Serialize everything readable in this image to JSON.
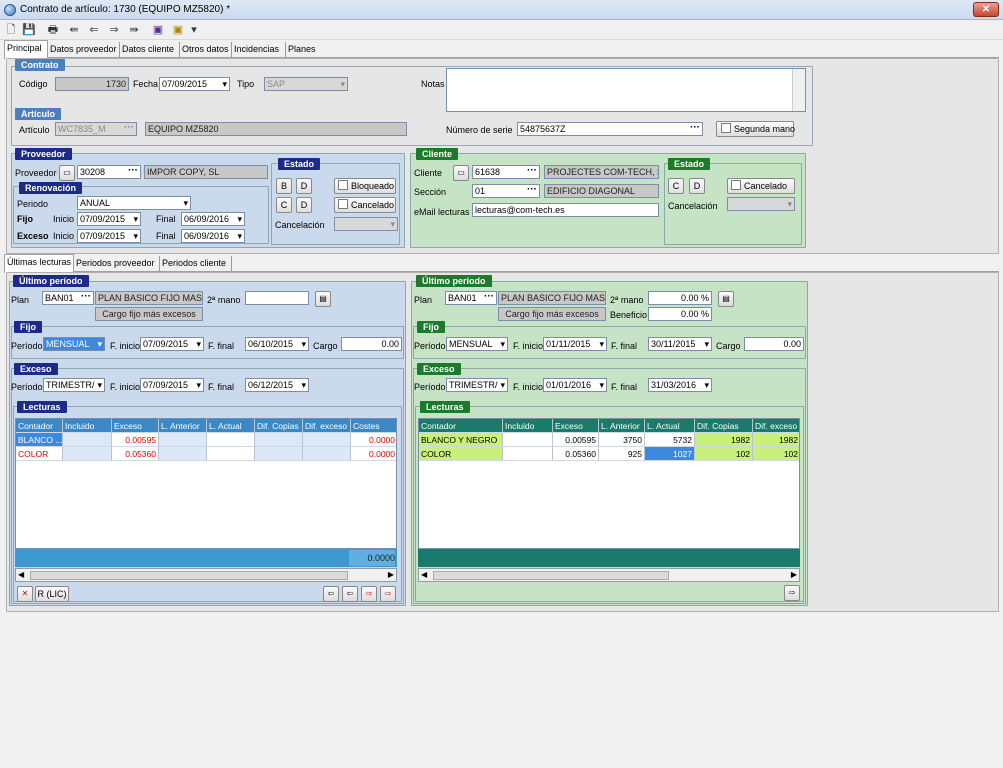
{
  "window": {
    "title": "Contrato de artículo: 1730 (EQUIPO MZ5820) *",
    "close": "✕"
  },
  "toolbar": {
    "new": "🗋",
    "save": "💾",
    "print": "🖶",
    "first": "⇚",
    "prev": "⇐",
    "next": "⇒",
    "last": "⇛",
    "a": "▣",
    "b": "▣",
    "more": "▾"
  },
  "tabs": [
    "Principal",
    "Datos proveedor",
    "Datos cliente",
    "Otros datos",
    "Incidencias",
    "Planes"
  ],
  "contrato": {
    "header": "Contrato",
    "codigo_label": "Código",
    "codigo": "1730",
    "fecha_label": "Fecha",
    "fecha": "07/09/2015",
    "tipo_label": "Tipo",
    "tipo": "SAP",
    "notas_label": "Notas",
    "notas": ""
  },
  "articulo": {
    "header": "Artículo",
    "articulo_label": "Artículo",
    "articulo": "WC7835_M",
    "descripcion": "EQUIPO MZ5820",
    "serie_label": "Número de serie",
    "serie": "54875637Z",
    "segunda_mano": "Segunda mano"
  },
  "proveedor": {
    "header": "Proveedor",
    "label": "Proveedor",
    "codigo": "30208",
    "nombre": "IMPOR COPY, SL",
    "renovacion": {
      "header": "Renovación",
      "periodo_label": "Periodo",
      "periodo": "ANUAL",
      "fijo_label": "Fijo",
      "exceso_label": "Exceso",
      "inicio_label": "Inicio",
      "final_label": "Final",
      "fijo_inicio": "07/09/2015",
      "fijo_final": "06/09/2016",
      "exceso_inicio": "07/09/2015",
      "exceso_final": "06/09/2016"
    },
    "estado": {
      "header": "Estado",
      "b": "B",
      "d": "D",
      "c": "C",
      "d2": "D",
      "bloqueado": "Bloqueado",
      "cancelado": "Cancelado",
      "cancelacion_label": "Cancelación"
    }
  },
  "cliente": {
    "header": "Cliente",
    "cliente_label": "Cliente",
    "codigo": "61638",
    "nombre": "PROJECTES COM-TECH, SL",
    "seccion_label": "Sección",
    "seccion": "01",
    "seccion_nombre": "EDIFICIO DIAGONAL",
    "email_label": "eMail lecturas",
    "email": "lecturas@com-tech.es",
    "estado": {
      "header": "Estado",
      "c": "C",
      "d": "D",
      "cancelado": "Cancelado",
      "cancelacion_label": "Cancelación"
    }
  },
  "subtabs": [
    "Últimas lecturas",
    "Periodos proveedor",
    "Periodos cliente"
  ],
  "left": {
    "ultimo": {
      "header": "Último período",
      "plan_label": "Plan",
      "plan": "BAN01",
      "plan_desc": "PLAN BASICO FIJO MAS E:",
      "segunda_label": "2ª mano",
      "cargo_desc": "Cargo fijo más excesos"
    },
    "fijo": {
      "header": "Fijo",
      "periodo_label": "Período",
      "periodo": "MENSUAL",
      "finicio_label": "F. inicio",
      "finicio": "07/09/2015",
      "ffinal_label": "F. final",
      "ffinal": "06/10/2015",
      "cargo_label": "Cargo",
      "cargo": "0.00"
    },
    "exceso": {
      "header": "Exceso",
      "periodo_label": "Período",
      "periodo": "TRIMESTR/",
      "finicio_label": "F. inicio",
      "finicio": "07/09/2015",
      "ffinal_label": "F. final",
      "ffinal": "06/12/2015"
    },
    "lecturas": {
      "header": "Lecturas",
      "columns": [
        "Contador",
        "Incluido",
        "Exceso",
        "L. Anterior",
        "L. Actual",
        "Dif. Copias",
        "Dif. exceso",
        "Costes"
      ],
      "rows": [
        [
          "BLANCO ...",
          "",
          "0.00595",
          "",
          "",
          "",
          "",
          "0.0000"
        ],
        [
          "COLOR",
          "",
          "0.05360",
          "",
          "",
          "",
          "",
          "0.0000"
        ]
      ],
      "total": "0.0000",
      "rlic": "R (LIC)"
    }
  },
  "right": {
    "ultimo": {
      "header": "Último período",
      "plan_label": "Plan",
      "plan": "BAN01",
      "plan_desc": "PLAN BASICO FIJO MAS E:",
      "segunda_label": "2ª mano",
      "segunda": "0.00 %",
      "beneficio_label": "Beneficio",
      "beneficio": "0.00 %",
      "cargo_desc": "Cargo fijo más excesos"
    },
    "fijo": {
      "header": "Fijo",
      "periodo_label": "Período",
      "periodo": "MENSUAL",
      "finicio_label": "F. inicio",
      "finicio": "01/11/2015",
      "ffinal_label": "F. final",
      "ffinal": "30/11/2015",
      "cargo_label": "Cargo",
      "cargo": "0.00"
    },
    "exceso": {
      "header": "Exceso",
      "periodo_label": "Período",
      "periodo": "TRIMESTR/",
      "finicio_label": "F. inicio",
      "finicio": "01/01/2016",
      "ffinal_label": "F. final",
      "ffinal": "31/03/2016"
    },
    "lecturas": {
      "header": "Lecturas",
      "columns": [
        "Contador",
        "Incluido",
        "Exceso",
        "L. Anterior",
        "L. Actual",
        "Dif. Copias",
        "Dif. exceso"
      ],
      "rows": [
        [
          "BLANCO Y NEGRO",
          "",
          "0.00595",
          "3750",
          "5732",
          "1982",
          "1982"
        ],
        [
          "COLOR",
          "",
          "0.05360",
          "925",
          "1027",
          "102",
          "102"
        ]
      ]
    }
  },
  "colors": {
    "blue_panel": "#cbd9ec",
    "green_panel": "#c6e3c6",
    "green_cell": "#c8f07a",
    "selected": "#3c8ae0"
  }
}
